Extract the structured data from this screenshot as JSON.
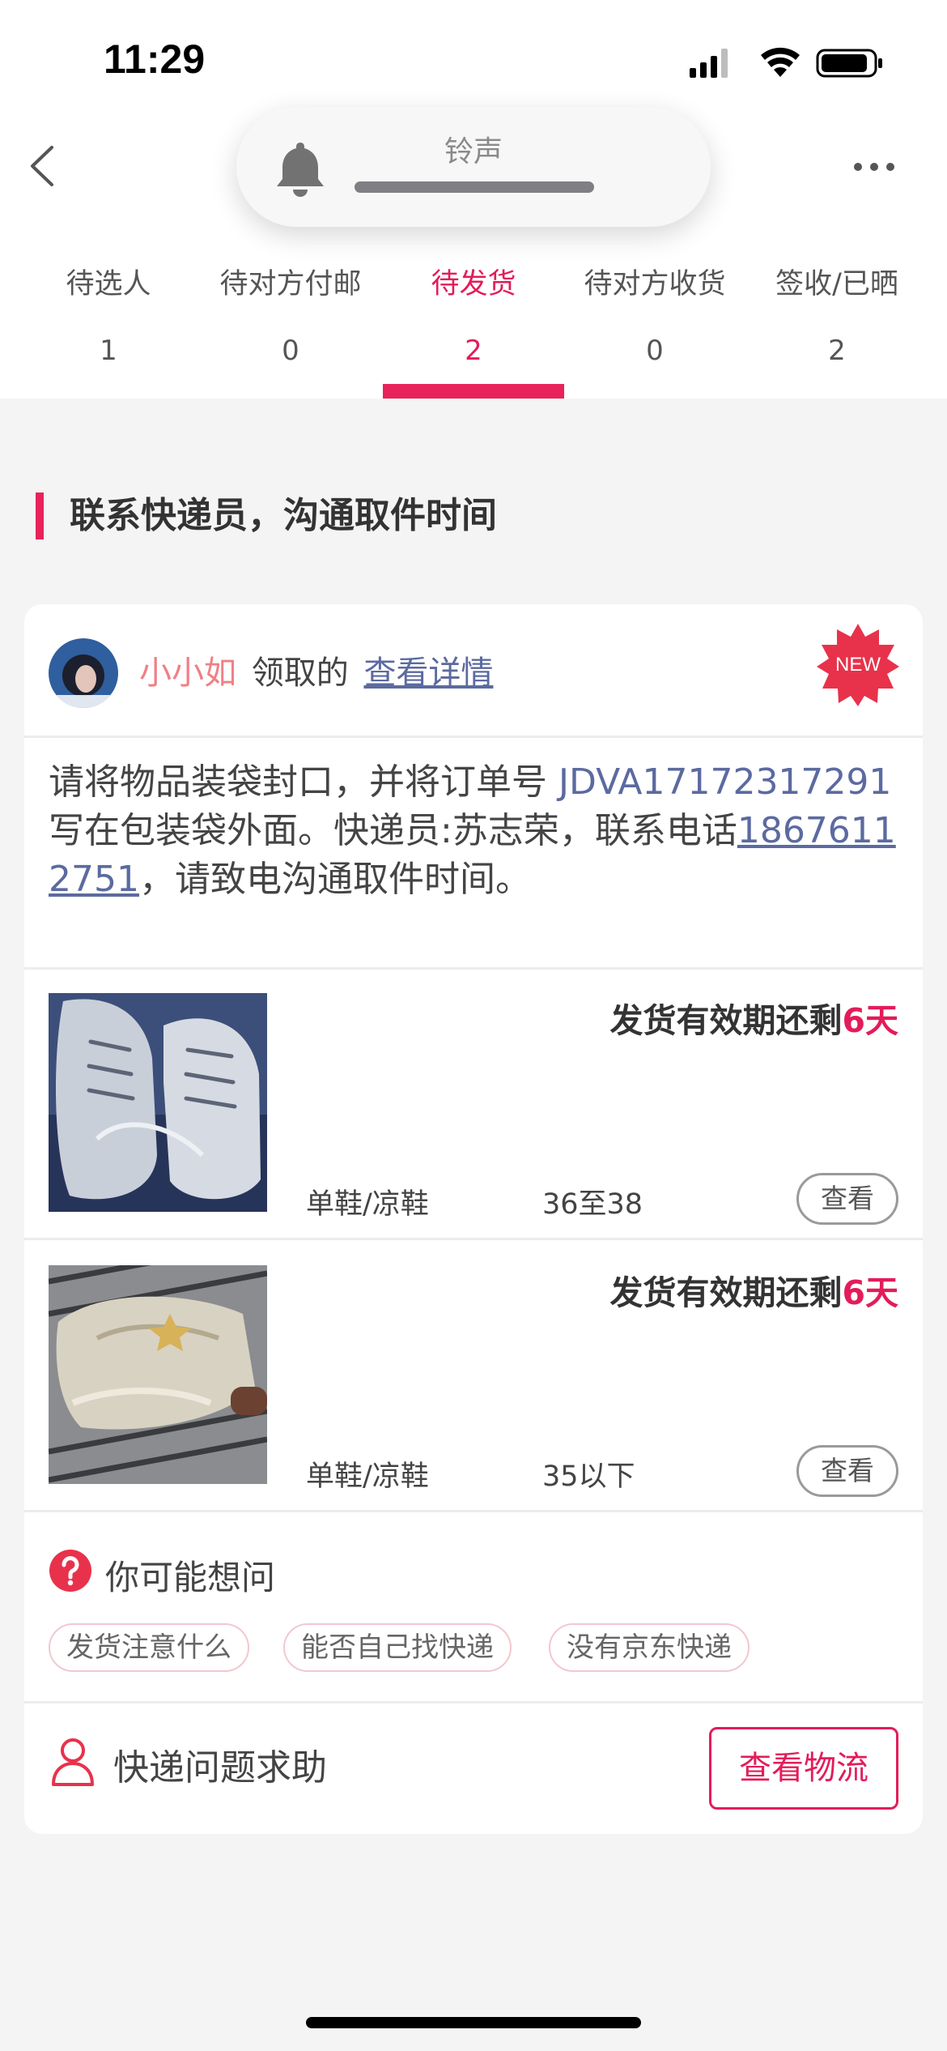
{
  "status_bar": {
    "time": "11:29"
  },
  "ringer": {
    "label": "铃声"
  },
  "tabs": [
    {
      "label": "待选人",
      "count": "1"
    },
    {
      "label": "待对方付邮",
      "count": "0"
    },
    {
      "label": "待发货",
      "count": "2",
      "active": true
    },
    {
      "label": "待对方收货",
      "count": "0"
    },
    {
      "label": "签收/已晒",
      "count": "2"
    }
  ],
  "section": {
    "title": "联系快递员，沟通取件时间"
  },
  "order": {
    "claimer": "小小如",
    "claimed_text": "领取的",
    "detail_link": "查看详情",
    "badge": "NEW",
    "instructions_pre": "请将物品装袋封口，并将订单号 ",
    "order_number": "JDVA17172317291",
    "instructions_mid": " 写在包装袋外面。快递员:苏志荣，联系电话",
    "phone": "18676112751",
    "instructions_post": "，请致电沟通取件时间。"
  },
  "items": [
    {
      "deadline_prefix": "发货有效期还剩",
      "deadline_days": "6天",
      "category": "单鞋/凉鞋",
      "size": "36至38",
      "view_label": "查看"
    },
    {
      "deadline_prefix": "发货有效期还剩",
      "deadline_days": "6天",
      "category": "单鞋/凉鞋",
      "size": "35以下",
      "view_label": "查看"
    }
  ],
  "faq": {
    "title": "你可能想问",
    "chips": [
      "发货注意什么",
      "能否自己找快递",
      "没有京东快递"
    ]
  },
  "help": {
    "text": "快递问题求助",
    "logistics_button": "查看物流"
  },
  "colors": {
    "accent": "#e31c5a",
    "link": "#5b6aa0",
    "claimer": "#f07f85"
  }
}
